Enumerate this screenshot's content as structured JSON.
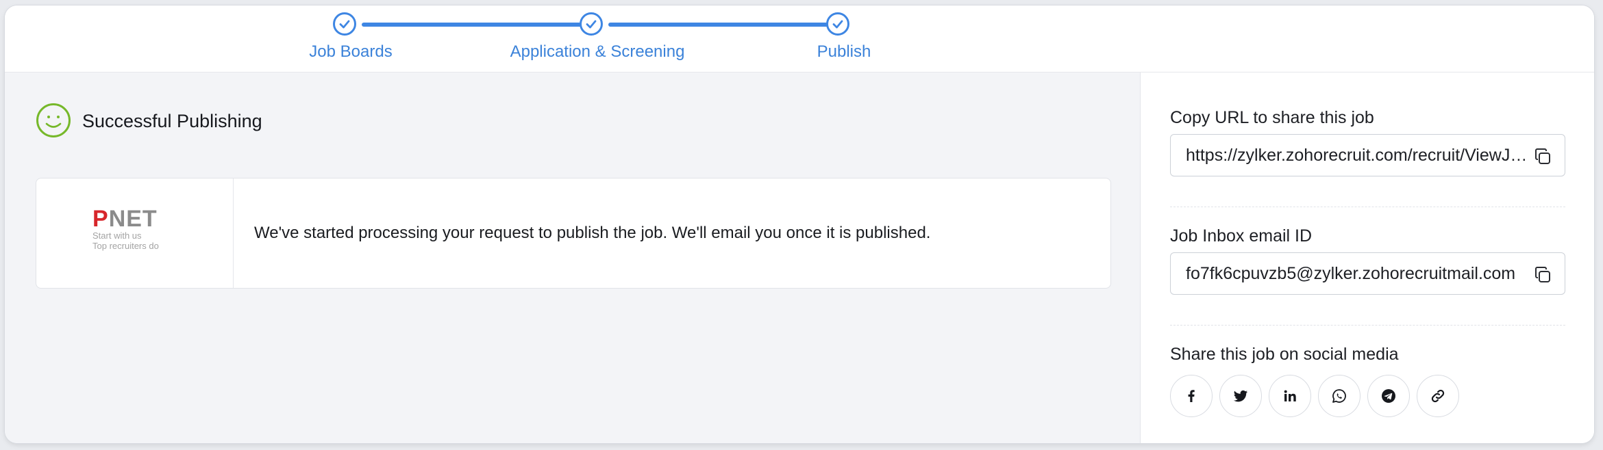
{
  "stepper": {
    "steps": [
      {
        "label": "Job Boards",
        "completed": true
      },
      {
        "label": "Application & Screening",
        "completed": true
      },
      {
        "label": "Publish",
        "completed": true
      }
    ],
    "accent_color": "#3e86e3"
  },
  "status": {
    "title": "Successful Publishing",
    "icon": "smiley-icon",
    "icon_color": "#76b82a"
  },
  "job_board_card": {
    "logo": {
      "name_first_letter": "P",
      "name_rest": "NET",
      "tagline_line1": "Start with us",
      "tagline_line2": "Top recruiters do"
    },
    "message": "We've started processing your request to publish the job. We'll email you once it is published."
  },
  "share": {
    "url_label": "Copy URL to share this job",
    "url_value": "https://zylker.zohorecruit.com/recruit/ViewJob.na?digest=",
    "email_label": "Job Inbox email ID",
    "email_value": "fo7fk6cpuvzb5@zylker.zohorecruitmail.com",
    "social_label": "Share this job on social media",
    "social_icons": [
      "facebook-icon",
      "twitter-icon",
      "linkedin-icon",
      "whatsapp-icon",
      "telegram-icon",
      "link-icon"
    ]
  }
}
